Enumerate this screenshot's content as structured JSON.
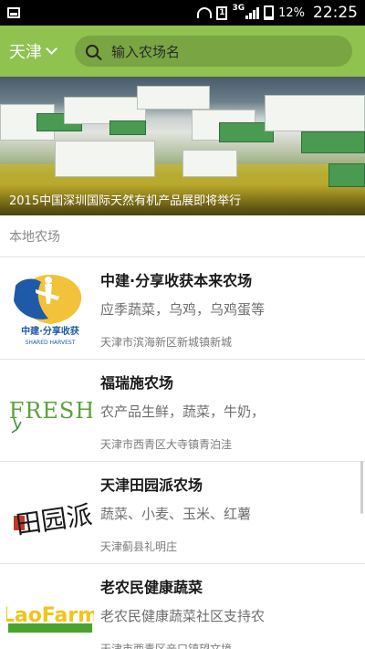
{
  "status_bar": {
    "carrier_sim": "1",
    "network": "3G",
    "battery": "12%",
    "time": "22:25"
  },
  "header": {
    "city": "天津",
    "search_placeholder": "输入农场名"
  },
  "banner": {
    "caption": "2015中国深圳国际天然有机产品展即将举行"
  },
  "section_title": "本地农场",
  "farms": [
    {
      "name": "中建·分享收获本来农场",
      "desc": "应季蔬菜，乌鸡，乌鸡蛋等",
      "addr": "天津市滨海新区新城镇新城",
      "logo": {
        "line1": "中建·分享收获",
        "line2": "SHARED HARVEST"
      }
    },
    {
      "name": "福瑞施农场",
      "desc": "农产品生鲜，蔬菜，牛奶，",
      "addr": "天津市西青区大寺镇青泊洼",
      "logo": {
        "text": "FRESH"
      }
    },
    {
      "name": "天津田园派农场",
      "desc": "蔬菜、小麦、玉米、红薯",
      "addr": "天津蓟县礼明庄",
      "logo": {
        "text": "田园派"
      }
    },
    {
      "name": "老农民健康蔬菜",
      "desc": "老农民健康蔬菜社区支持农",
      "addr": "天津市西青区辛口镇望文境",
      "logo": {
        "text": "LaoFarm"
      }
    }
  ],
  "colors": {
    "accent": "#8fc24f",
    "farm1_blue": "#1f5aa8",
    "farm1_yellow": "#f2c23a",
    "farm2_green": "#3b8a3c"
  }
}
